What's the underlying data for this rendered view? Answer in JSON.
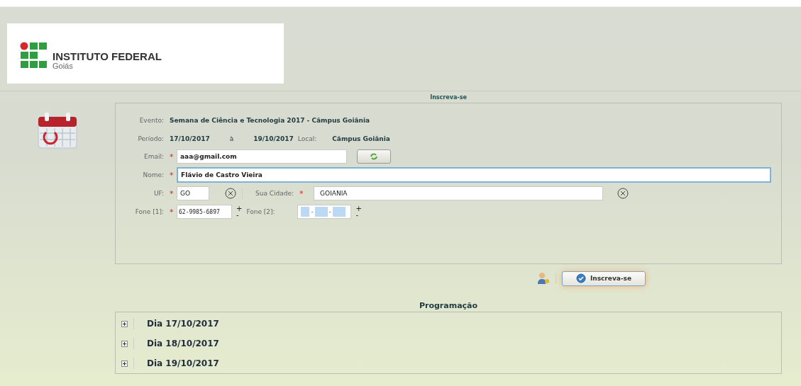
{
  "logo": {
    "title": "INSTITUTO FEDERAL",
    "subtitle": "Goiás"
  },
  "form_title": "Inscreva-se",
  "evento": {
    "label": "Evento:",
    "value": "Semana de Ciência e Tecnologia 2017 - Câmpus Goiânia"
  },
  "periodo": {
    "label": "Período:",
    "start": "17/10/2017",
    "separator": "à",
    "end": "19/10/2017",
    "local_label": "Local:",
    "local": "Câmpus Goiânia"
  },
  "email": {
    "label": "Email:",
    "required_mark": "*",
    "value": "aaa@gmail.com"
  },
  "nome": {
    "label": "Nome:",
    "required_mark": "*",
    "value": "Flávio de Castro Vieira",
    "focused": true
  },
  "uf": {
    "label": "UF:",
    "required_mark": "*",
    "value": "GO"
  },
  "cidade": {
    "label": "Sua Cidade:",
    "required_mark": "*",
    "value": "GOIANIA"
  },
  "fone_1": {
    "label": "Fone [1]:",
    "required_mark": "*",
    "value": "62-9985-6897",
    "add": "+",
    "remove": "-"
  },
  "fone_2": {
    "label": "Fone [2]:",
    "mask_separators": [
      "-",
      "-"
    ],
    "add": "+",
    "remove": "-"
  },
  "submit_button": "Inscreva-se",
  "programacao": {
    "title": "Programação",
    "days": [
      {
        "label": "Dia 17/10/2017",
        "expanded": false
      },
      {
        "label": "Dia 18/10/2017",
        "expanded": false
      },
      {
        "label": "Dia 19/10/2017",
        "expanded": false
      }
    ]
  }
}
